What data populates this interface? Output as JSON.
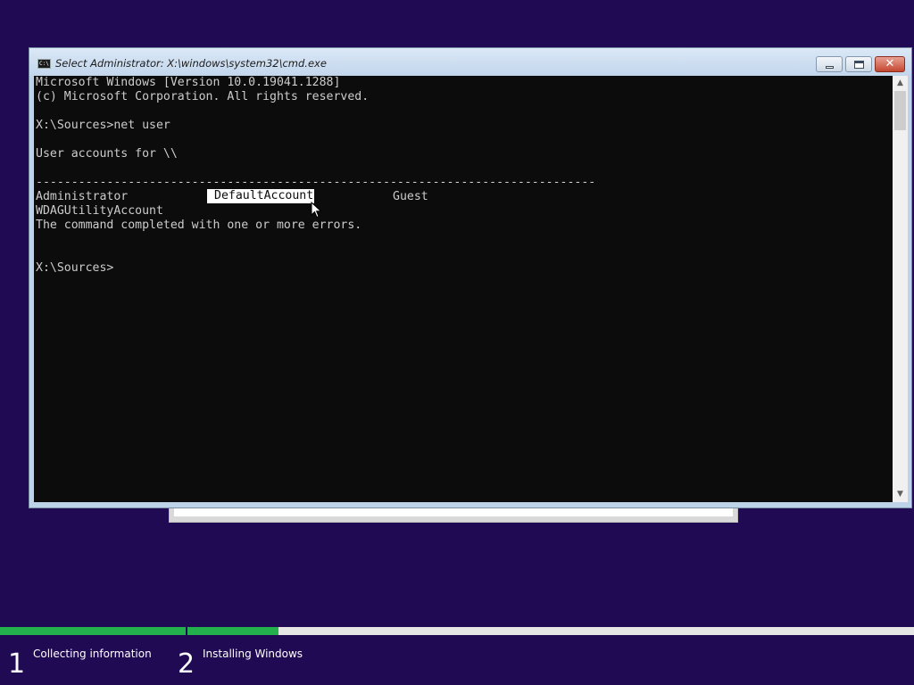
{
  "window": {
    "title": "Select Administrator: X:\\windows\\system32\\cmd.exe",
    "icon": "cmd-icon",
    "icon_text": "C:\\"
  },
  "console": {
    "lines": [
      "Microsoft Windows [Version 10.0.19041.1288]",
      "(c) Microsoft Corporation. All rights reserved.",
      "",
      "X:\\Sources>net user",
      "",
      "User accounts for \\\\",
      "",
      "-------------------------------------------------------------------------------",
      "Administrator",
      "WDAGUtilityAccount",
      "The command completed with one or more errors.",
      "",
      "",
      "X:\\Sources>"
    ],
    "selected_text": "DefaultAccount",
    "guest_text": "Guest"
  },
  "setup": {
    "steps": [
      {
        "number": "1",
        "label": "Collecting information",
        "progress": 1.0
      },
      {
        "number": "2",
        "label": "Installing Windows",
        "progress": 0.125
      }
    ],
    "accent_color": "#23b14d",
    "background_color": "#200a54"
  }
}
